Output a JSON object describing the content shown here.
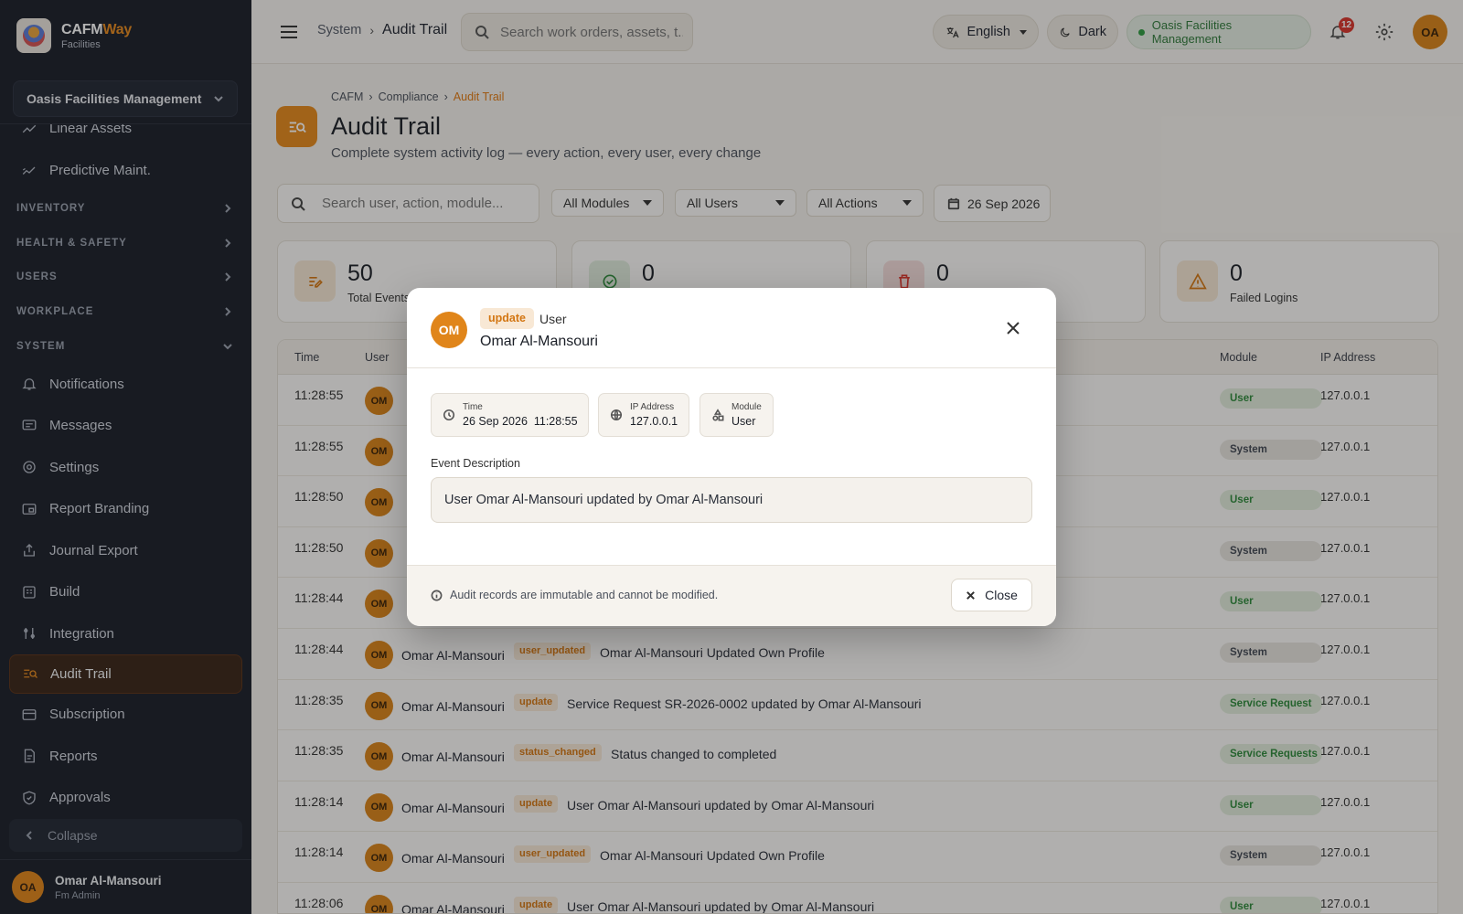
{
  "brand": {
    "name_main": "CAFM",
    "name_accent": "Way",
    "subtitle": "Facilities"
  },
  "org_select": {
    "label": "Oasis Facilities Management"
  },
  "sidebar": {
    "top_items": [
      {
        "label": "Linear Assets",
        "icon": "trend-line-icon"
      },
      {
        "label": "Predictive Maint.",
        "icon": "trend-chart-icon"
      }
    ],
    "sections": [
      "INVENTORY",
      "HEALTH & SAFETY",
      "USERS",
      "WORKPLACE",
      "SYSTEM"
    ],
    "system_items": [
      {
        "label": "Notifications",
        "icon": "bell-icon"
      },
      {
        "label": "Messages",
        "icon": "message-icon"
      },
      {
        "label": "Settings",
        "icon": "gear-icon"
      },
      {
        "label": "Report Branding",
        "icon": "branding-icon"
      },
      {
        "label": "Journal Export",
        "icon": "upload-icon"
      },
      {
        "label": "Build",
        "icon": "build-icon"
      },
      {
        "label": "Integration",
        "icon": "integration-icon"
      },
      {
        "label": "Audit Trail",
        "icon": "audit-icon",
        "active": true
      },
      {
        "label": "Subscription",
        "icon": "card-icon"
      },
      {
        "label": "Reports",
        "icon": "report-icon"
      },
      {
        "label": "Approvals",
        "icon": "shield-check-icon"
      }
    ],
    "collapse_label": "Collapse",
    "user": {
      "initials": "OA",
      "name": "Omar Al-Mansouri",
      "role": "Fm Admin"
    }
  },
  "topbar": {
    "crumb_parent": "System",
    "crumb_current": "Audit Trail",
    "search_placeholder": "Search work orders, assets, t...",
    "language": "English",
    "theme": "Dark",
    "org": "Oasis Facilities Management",
    "notifications": "12",
    "avatar": "OA"
  },
  "page": {
    "breadcrumb": [
      "CAFM",
      "Compliance",
      "Audit Trail"
    ],
    "title": "Audit Trail",
    "subtitle": "Complete system activity log — every action, every user, every change"
  },
  "filters": {
    "search_placeholder": "Search user, action, module...",
    "modules": "All Modules",
    "users": "All Users",
    "actions": "All Actions",
    "date": "26 Sep 2026"
  },
  "stats": [
    {
      "value": "50",
      "label": "Total Events",
      "icon": "edit-icon"
    },
    {
      "value": "0",
      "label": "",
      "icon": "check-circle-icon"
    },
    {
      "value": "0",
      "label": "",
      "icon": "trash-icon"
    },
    {
      "value": "0",
      "label": "Failed Logins",
      "icon": "warning-icon"
    }
  ],
  "table": {
    "headers": {
      "time": "Time",
      "user": "User",
      "module": "Module",
      "ip": "IP Address"
    },
    "rows": [
      {
        "time": "11:28:55",
        "initials": "OM",
        "user": "",
        "action": "",
        "desc": "",
        "module": "User",
        "ip": "127.0.0.1",
        "tone": "green"
      },
      {
        "time": "11:28:55",
        "initials": "OM",
        "user": "",
        "action": "",
        "desc": "",
        "module": "System",
        "ip": "127.0.0.1",
        "tone": "gray"
      },
      {
        "time": "11:28:50",
        "initials": "OM",
        "user": "",
        "action": "",
        "desc": "",
        "module": "User",
        "ip": "127.0.0.1",
        "tone": "green"
      },
      {
        "time": "11:28:50",
        "initials": "OM",
        "user": "",
        "action": "",
        "desc": "",
        "module": "System",
        "ip": "127.0.0.1",
        "tone": "gray"
      },
      {
        "time": "11:28:44",
        "initials": "OM",
        "user": "",
        "action": "",
        "desc": "",
        "module": "User",
        "ip": "127.0.0.1",
        "tone": "green"
      },
      {
        "time": "11:28:44",
        "initials": "OM",
        "user": "Omar Al-Mansouri",
        "action": "user_updated",
        "desc": "Omar Al-Mansouri Updated Own Profile",
        "module": "System",
        "ip": "127.0.0.1",
        "tone": "gray"
      },
      {
        "time": "11:28:35",
        "initials": "OM",
        "user": "Omar Al-Mansouri",
        "action": "update",
        "desc": "Service Request SR-2026-0002 updated by Omar Al-Mansouri",
        "module": "Service Request",
        "ip": "127.0.0.1",
        "tone": "green"
      },
      {
        "time": "11:28:35",
        "initials": "OM",
        "user": "Omar Al-Mansouri",
        "action": "status_changed",
        "desc": "Status changed to completed",
        "module": "Service Requests",
        "ip": "127.0.0.1",
        "tone": "green"
      },
      {
        "time": "11:28:14",
        "initials": "OM",
        "user": "Omar Al-Mansouri",
        "action": "update",
        "desc": "User Omar Al-Mansouri updated by Omar Al-Mansouri",
        "module": "User",
        "ip": "127.0.0.1",
        "tone": "green"
      },
      {
        "time": "11:28:14",
        "initials": "OM",
        "user": "Omar Al-Mansouri",
        "action": "user_updated",
        "desc": "Omar Al-Mansouri Updated Own Profile",
        "module": "System",
        "ip": "127.0.0.1",
        "tone": "gray"
      },
      {
        "time": "11:28:06",
        "initials": "OM",
        "user": "Omar Al-Mansouri",
        "action": "update",
        "desc": "User Omar Al-Mansouri updated by Omar Al-Mansouri",
        "module": "User",
        "ip": "127.0.0.1",
        "tone": "green"
      }
    ]
  },
  "modal": {
    "initials": "OM",
    "action": "update",
    "module": "User",
    "user": "Omar Al-Mansouri",
    "time_label": "Time",
    "time_value": "26 Sep 2026  11:28:55",
    "ip_label": "IP Address",
    "ip_value": "127.0.0.1",
    "module_label": "Module",
    "module_value": "User",
    "description_label": "Event Description",
    "description": "User Omar Al-Mansouri updated by Omar Al-Mansouri",
    "note": "Audit records are immutable and cannot be modified.",
    "close_label": "Close"
  },
  "colors": {
    "accent": "#e58a1c",
    "sidebar": "#1b1f2a",
    "success": "#2f8a3c",
    "danger": "#d9342b"
  }
}
